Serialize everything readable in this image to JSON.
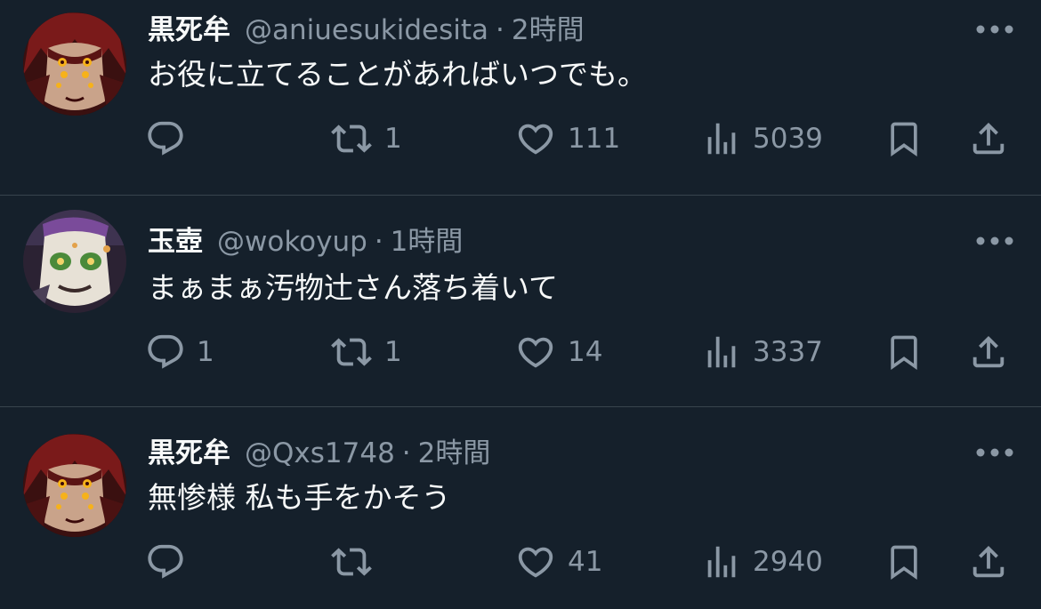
{
  "colors": {
    "background": "#15202b",
    "text_primary": "#f7f9f9",
    "text_secondary": "#8b98a5",
    "divider": "#38444d"
  },
  "icons": {
    "reply": "reply-icon",
    "retweet": "retweet-icon",
    "like": "heart-icon",
    "views": "views-chart-icon",
    "bookmark": "bookmark-icon",
    "share": "share-icon",
    "more": "more-options-icon"
  },
  "tweets": [
    {
      "name": "黒死牟",
      "handle": "@aniuesukidesita",
      "dot": "·",
      "time": "2時間",
      "text": "お役に立てることがあればいつでも。",
      "replies": "",
      "retweets": "1",
      "likes": "111",
      "views": "5039"
    },
    {
      "name": "玉壺",
      "handle": "@wokoyup",
      "dot": "·",
      "time": "1時間",
      "text": "まぁまぁ汚物辻さん落ち着いて",
      "replies": "1",
      "retweets": "1",
      "likes": "14",
      "views": "3337"
    },
    {
      "name": "黒死牟",
      "handle": "@Qxs1748",
      "dot": "·",
      "time": "2時間",
      "text": "無惨様 私も手をかそう",
      "replies": "",
      "retweets": "",
      "likes": "41",
      "views": "2940"
    }
  ]
}
